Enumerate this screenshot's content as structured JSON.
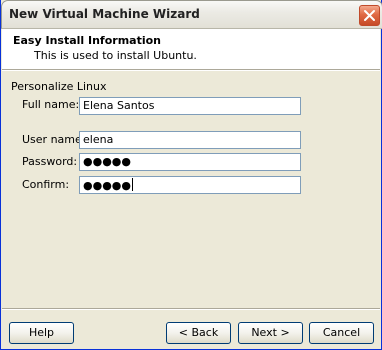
{
  "window": {
    "title": "New Virtual Machine Wizard"
  },
  "header": {
    "title": "Easy Install Information",
    "subtitle": "This is used to install Ubuntu."
  },
  "form": {
    "section_label": "Personalize Linux",
    "full_name": {
      "label": "Full name:",
      "value": "Elena Santos"
    },
    "user_name": {
      "label": "User name:",
      "value": "elena"
    },
    "password": {
      "label": "Password:",
      "value": "●●●●●"
    },
    "confirm": {
      "label": "Confirm:",
      "value": "●●●●●"
    }
  },
  "buttons": {
    "help": "Help",
    "back": "< Back",
    "next": "Next >",
    "cancel": "Cancel"
  },
  "icons": {
    "close": "close-icon"
  }
}
